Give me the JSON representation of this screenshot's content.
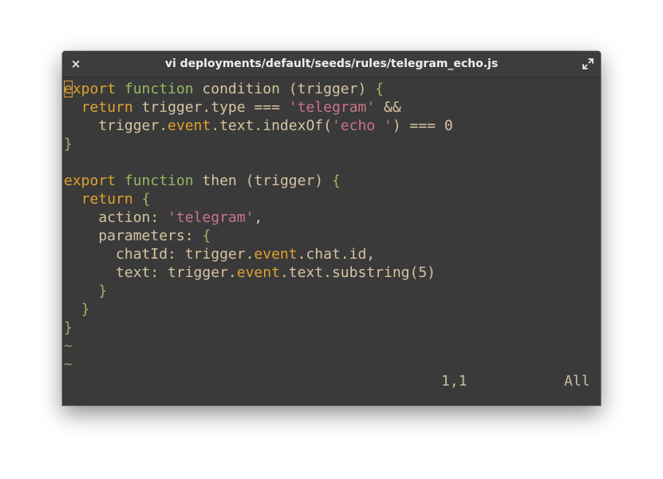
{
  "window": {
    "title": "vi deployments/default/seeds/rules/telegram_echo.js",
    "close_icon": "×",
    "maximize_icon": "maximize-icon"
  },
  "editor": {
    "lines": [
      [
        [
          "kw",
          "e"
        ],
        [
          "kw",
          "xport"
        ],
        [
          "plain",
          " "
        ],
        [
          "fn",
          "function"
        ],
        [
          "plain",
          " condition (trigger) "
        ],
        [
          "punc",
          "{"
        ]
      ],
      [
        [
          "plain",
          "  "
        ],
        [
          "kw",
          "return"
        ],
        [
          "plain",
          " trigger.type === "
        ],
        [
          "str",
          "'telegram'"
        ],
        [
          "plain",
          " &&"
        ]
      ],
      [
        [
          "plain",
          "    trigger."
        ],
        [
          "prop",
          "event"
        ],
        [
          "plain",
          ".text.indexOf("
        ],
        [
          "str",
          "'echo '"
        ],
        [
          "plain",
          ") === 0"
        ]
      ],
      [
        [
          "punc",
          "}"
        ]
      ],
      [
        [
          "plain",
          ""
        ]
      ],
      [
        [
          "kw",
          "export"
        ],
        [
          "plain",
          " "
        ],
        [
          "fn",
          "function"
        ],
        [
          "plain",
          " then (trigger) "
        ],
        [
          "punc",
          "{"
        ]
      ],
      [
        [
          "plain",
          "  "
        ],
        [
          "kw",
          "return"
        ],
        [
          "plain",
          " "
        ],
        [
          "punc",
          "{"
        ]
      ],
      [
        [
          "plain",
          "    action: "
        ],
        [
          "str",
          "'telegram'"
        ],
        [
          "plain",
          ","
        ]
      ],
      [
        [
          "plain",
          "    parameters: "
        ],
        [
          "punc",
          "{"
        ]
      ],
      [
        [
          "plain",
          "      chatId: trigger."
        ],
        [
          "prop",
          "event"
        ],
        [
          "plain",
          ".chat.id,"
        ]
      ],
      [
        [
          "plain",
          "      text: trigger."
        ],
        [
          "prop",
          "event"
        ],
        [
          "plain",
          ".text.substring(5)"
        ]
      ],
      [
        [
          "plain",
          "    "
        ],
        [
          "punc",
          "}"
        ]
      ],
      [
        [
          "plain",
          "  "
        ],
        [
          "punc",
          "}"
        ]
      ],
      [
        [
          "punc",
          "}"
        ]
      ],
      [
        [
          "tilde",
          "~"
        ]
      ],
      [
        [
          "tilde",
          "~"
        ]
      ]
    ]
  },
  "status": {
    "position": "1,1",
    "percent": "All"
  },
  "colors": {
    "keyword": "#e0a030",
    "function": "#98b862",
    "string": "#c9748a",
    "text": "#d5c4a1",
    "background": "#3a3a3a"
  }
}
